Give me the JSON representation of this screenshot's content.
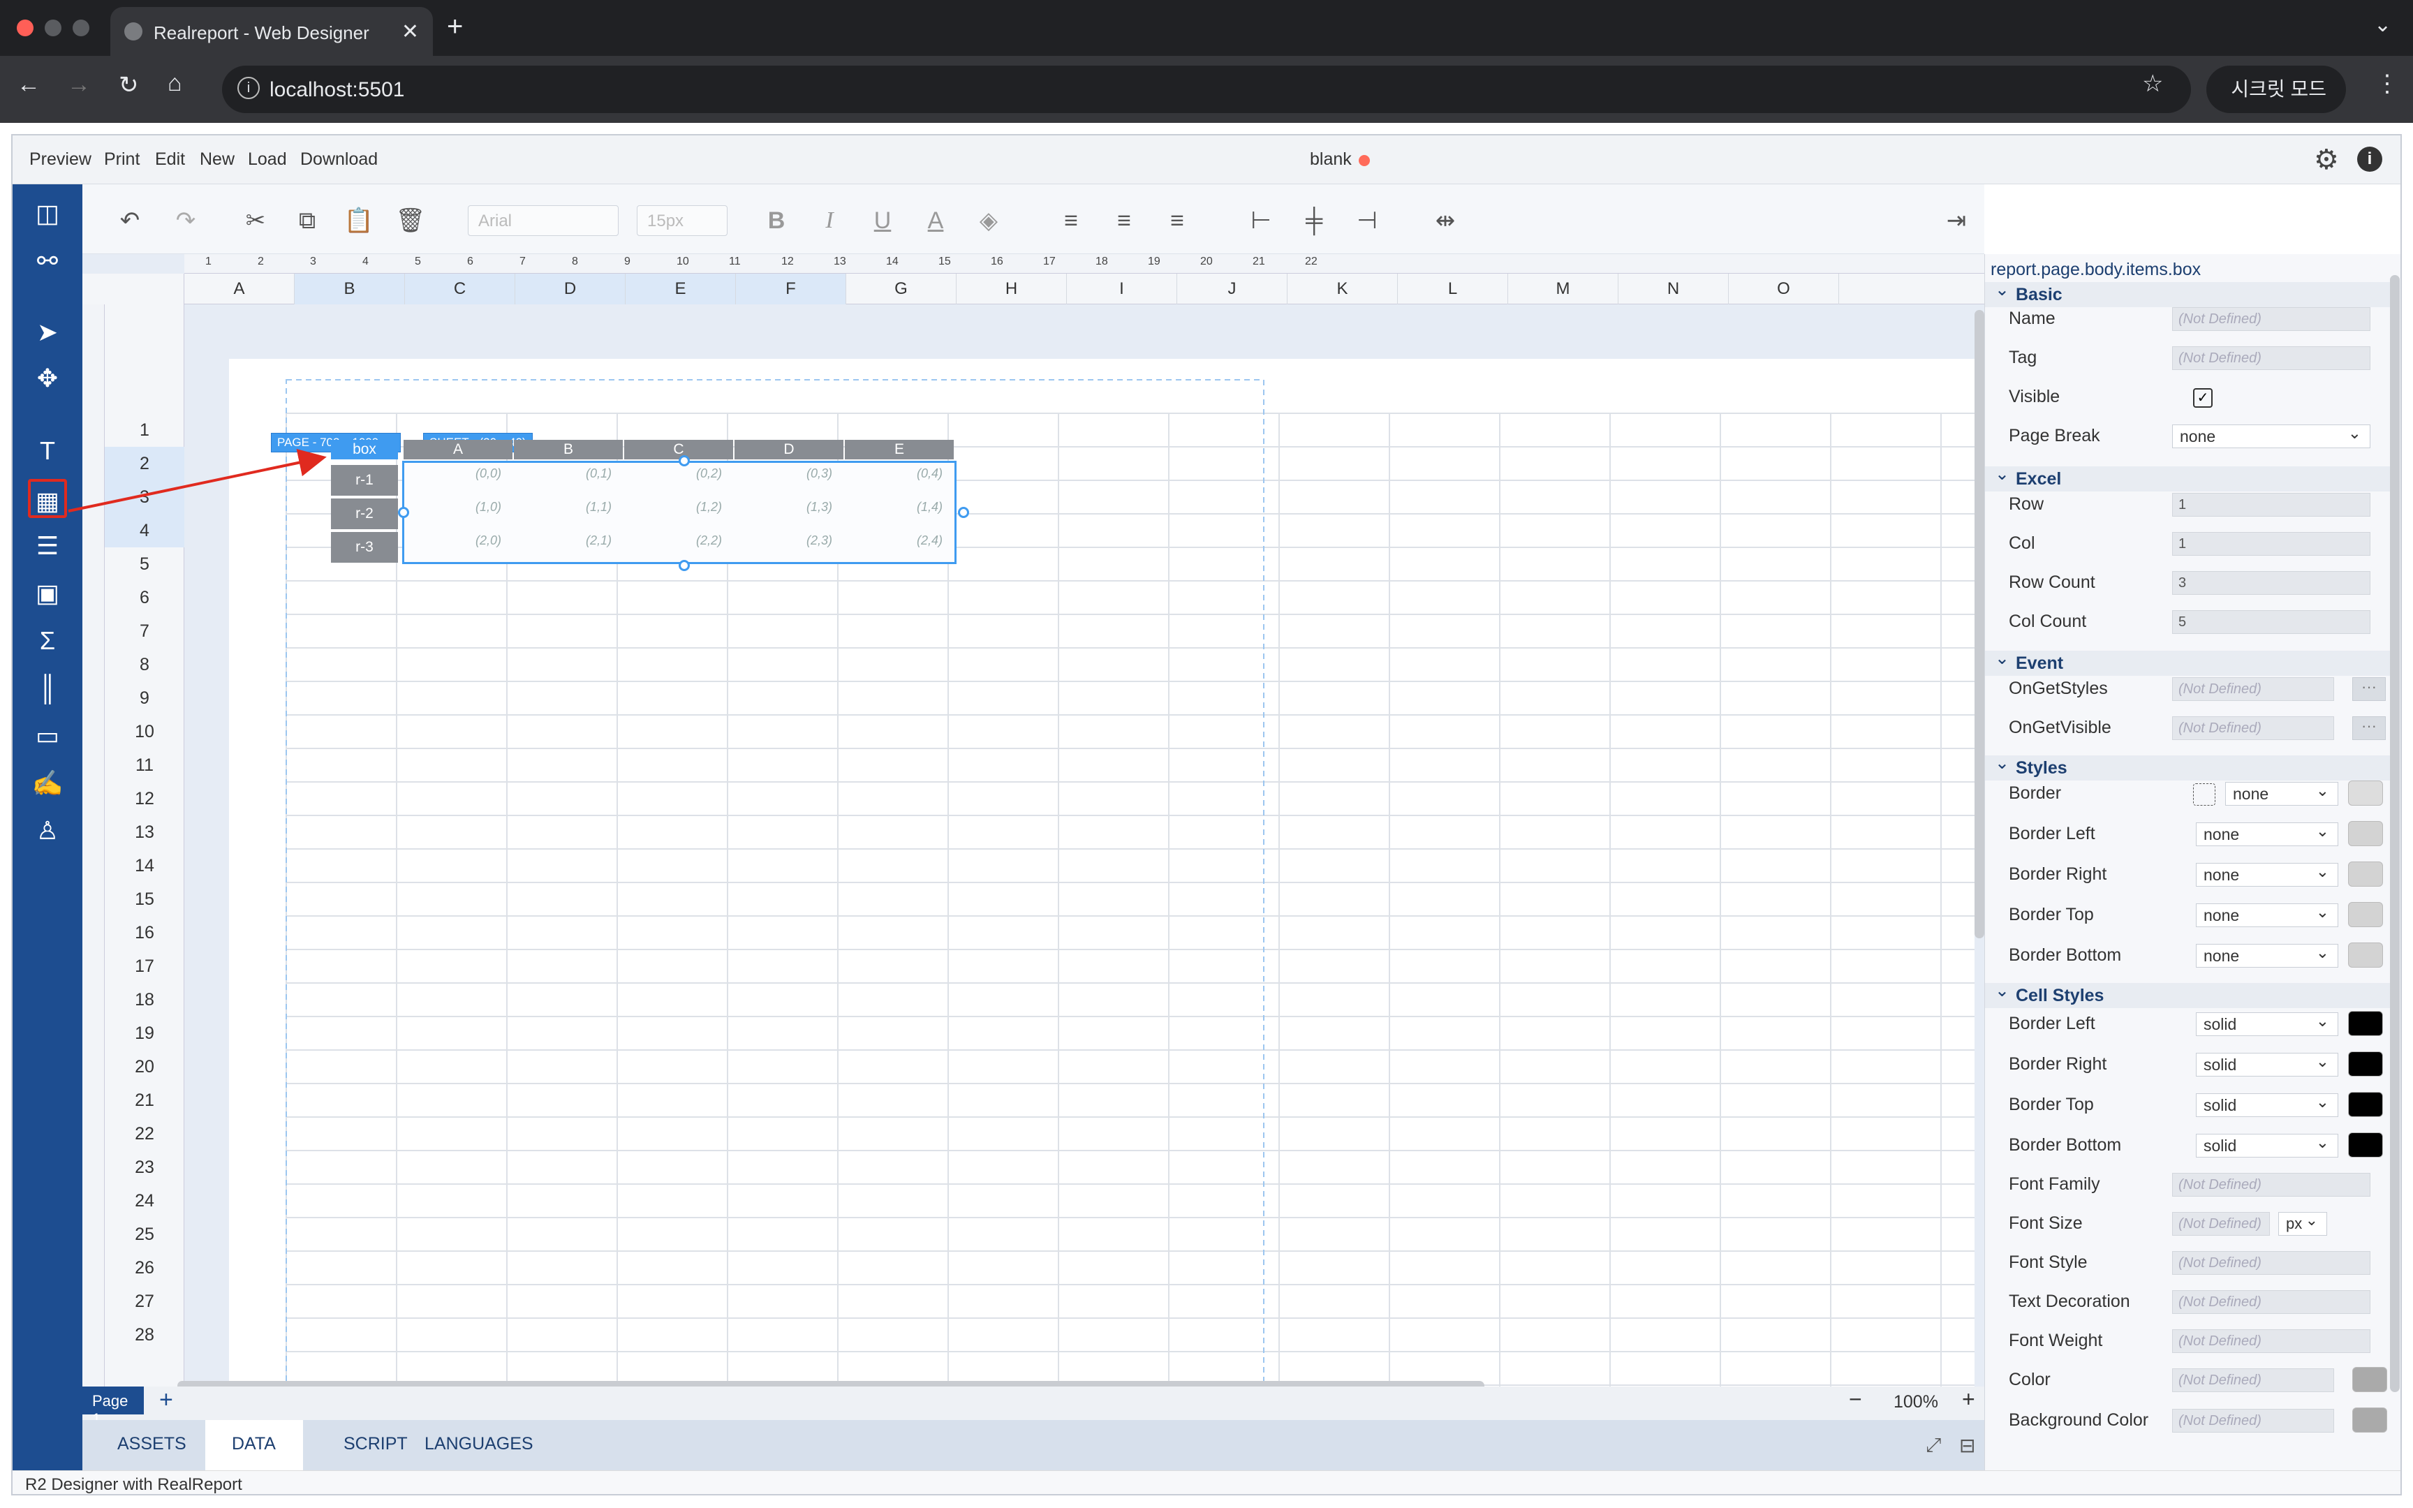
{
  "browser": {
    "tab_title": "Realreport - Web Designer",
    "new_tab": "+",
    "url": "localhost:5501",
    "incognito_label": "시크릿 모드"
  },
  "menu": {
    "items": [
      "Preview",
      "Print",
      "Edit",
      "New",
      "Load",
      "Download"
    ],
    "doc_title": "blank"
  },
  "toolbar": {
    "font_family": "Arial",
    "font_size": "15px"
  },
  "sheet": {
    "columns": [
      "A",
      "B",
      "C",
      "D",
      "E",
      "F",
      "G",
      "H",
      "I",
      "J",
      "K",
      "L",
      "M",
      "N",
      "O"
    ],
    "rows": [
      "1",
      "2",
      "3",
      "4",
      "5",
      "6",
      "7",
      "8",
      "9",
      "10",
      "11",
      "12",
      "13",
      "14",
      "15",
      "16",
      "17",
      "18",
      "19",
      "20",
      "21",
      "22",
      "23",
      "24",
      "25",
      "26",
      "27",
      "28"
    ],
    "ruler": [
      "1",
      "2",
      "3",
      "4",
      "5",
      "6",
      "7",
      "8",
      "9",
      "10",
      "11",
      "12",
      "13",
      "14",
      "15",
      "16",
      "17",
      "18",
      "19",
      "20",
      "21",
      "22"
    ],
    "page_badge": "PAGE - 702 x 1009 px",
    "sheet_badge": "SHEET - (20 x 40)"
  },
  "box": {
    "name": "box",
    "col_headers": [
      "A",
      "B",
      "C",
      "D",
      "E"
    ],
    "row_headers": [
      "r-1",
      "r-2",
      "r-3"
    ],
    "cells": [
      [
        "(0,0)",
        "(0,1)",
        "(0,2)",
        "(0,3)",
        "(0,4)"
      ],
      [
        "(1,0)",
        "(1,1)",
        "(1,2)",
        "(1,3)",
        "(1,4)"
      ],
      [
        "(2,0)",
        "(2,1)",
        "(2,2)",
        "(2,3)",
        "(2,4)"
      ]
    ]
  },
  "pages": {
    "current": "Page 1",
    "add": "+",
    "zoom": "100%",
    "zoom_out": "−",
    "zoom_in": "+"
  },
  "bottom_tabs": [
    "ASSETS",
    "DATA",
    "SCRIPT",
    "LANGUAGES"
  ],
  "bottom_active": "DATA",
  "status": "R2 Designer with RealReport",
  "props": {
    "path": "report.page.body.items.box",
    "sections": {
      "basic": "Basic",
      "excel": "Excel",
      "event": "Event",
      "styles": "Styles",
      "cell_styles": "Cell Styles"
    },
    "basic": {
      "name_label": "Name",
      "name_value": "(Not Defined)",
      "tag_label": "Tag",
      "tag_value": "(Not Defined)",
      "visible_label": "Visible",
      "page_break_label": "Page Break",
      "page_break_value": "none"
    },
    "excel": {
      "row_label": "Row",
      "row_value": "1",
      "col_label": "Col",
      "col_value": "1",
      "row_count_label": "Row Count",
      "row_count_value": "3",
      "col_count_label": "Col Count",
      "col_count_value": "5"
    },
    "event": {
      "on_get_styles_label": "OnGetStyles",
      "on_get_styles_value": "(Not Defined)",
      "on_get_visible_label": "OnGetVisible",
      "on_get_visible_value": "(Not Defined)",
      "more": "···"
    },
    "styles": {
      "border_label": "Border",
      "border_value": "none",
      "border_left_label": "Border Left",
      "border_left_value": "none",
      "border_right_label": "Border Right",
      "border_right_value": "none",
      "border_top_label": "Border Top",
      "border_top_value": "none",
      "border_bottom_label": "Border Bottom",
      "border_bottom_value": "none"
    },
    "cell_styles": {
      "border_left_label": "Border Left",
      "border_left_value": "solid",
      "border_right_label": "Border Right",
      "border_right_value": "solid",
      "border_top_label": "Border Top",
      "border_top_value": "solid",
      "border_bottom_label": "Border Bottom",
      "border_bottom_value": "solid",
      "font_family_label": "Font Family",
      "font_family_value": "(Not Defined)",
      "font_size_label": "Font Size",
      "font_size_value": "(Not Defined)",
      "font_size_unit": "px",
      "font_style_label": "Font Style",
      "font_style_value": "(Not Defined)",
      "text_decoration_label": "Text Decoration",
      "text_decoration_value": "(Not Defined)",
      "font_weight_label": "Font Weight",
      "font_weight_value": "(Not Defined)",
      "color_label": "Color",
      "color_value": "(Not Defined)",
      "background_color_label": "Background Color",
      "background_color_value": "(Not Defined)"
    }
  },
  "colors": {
    "accent": "#3f9bf0",
    "sidebar": "#1d4d90",
    "annotation_red": "#e02a1f"
  }
}
